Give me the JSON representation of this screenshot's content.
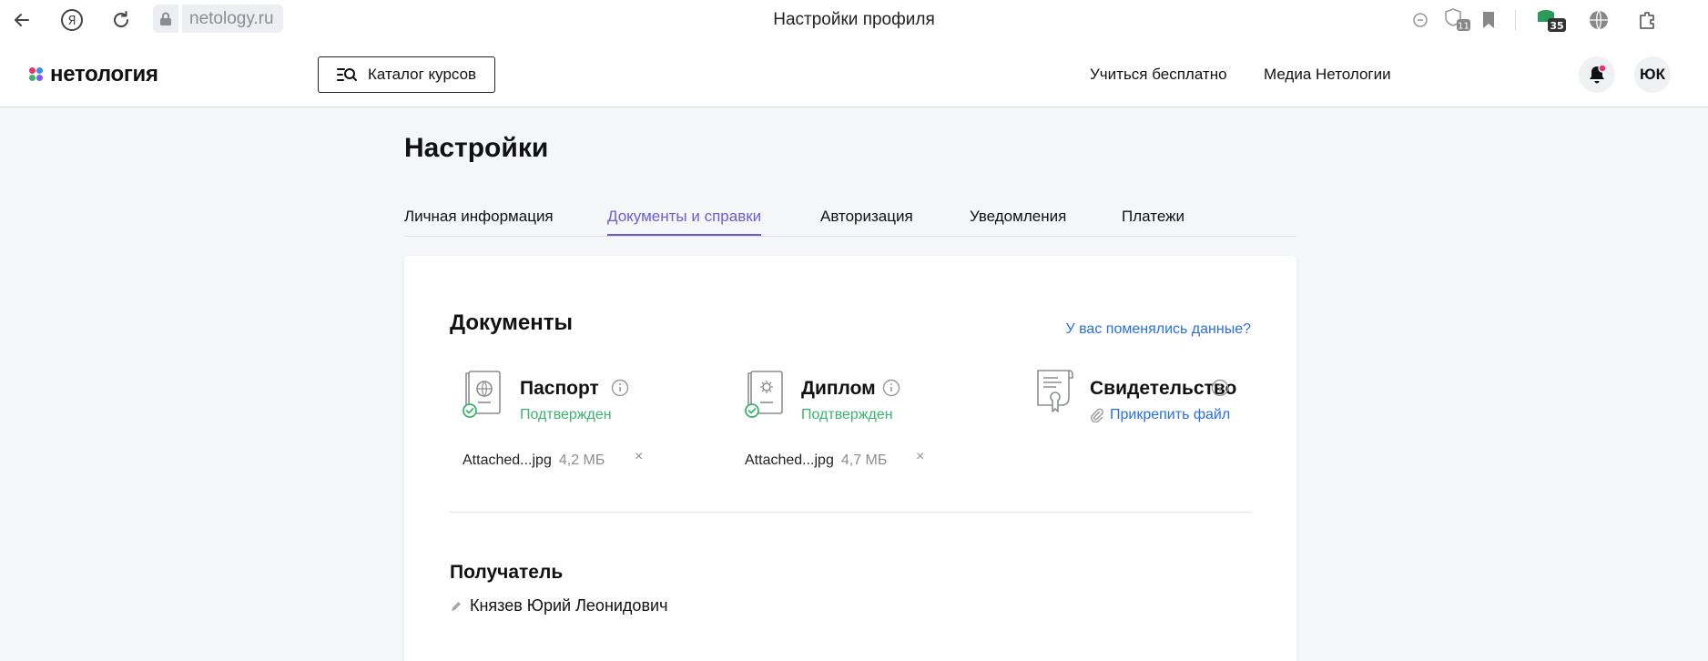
{
  "browser": {
    "url": "netology.ru",
    "tab_title": "Настройки профиля",
    "extensions": {
      "badge_1": "11",
      "badge_2": "35"
    }
  },
  "header": {
    "logo_text": "нетология",
    "catalog_button": "Каталог курсов",
    "nav": [
      "Учиться бесплатно",
      "Медиа Нетологии"
    ],
    "avatar_initials": "ЮК"
  },
  "page": {
    "title": "Настройки",
    "tabs": [
      {
        "label": "Личная информация",
        "active": false
      },
      {
        "label": "Документы и справки",
        "active": true
      },
      {
        "label": "Авторизация",
        "active": false
      },
      {
        "label": "Уведомления",
        "active": false
      },
      {
        "label": "Платежи",
        "active": false
      }
    ]
  },
  "documents": {
    "title": "Документы",
    "changed_link": "У вас поменялись данные?",
    "items": [
      {
        "name": "Паспорт",
        "status": "Подтвержден",
        "file_name": "Attached...jpg",
        "file_size": "4,2 МБ",
        "remove": "×"
      },
      {
        "name": "Диплом",
        "status": "Подтвержден",
        "file_name": "Attached...jpg",
        "file_size": "4,7 МБ",
        "remove": "×"
      },
      {
        "name": "Свидетельство",
        "attach_label": "Прикрепить файл"
      }
    ]
  },
  "recipient": {
    "title": "Получатель",
    "name": "Князев Юрий Леонидович"
  },
  "colors": {
    "accent": "#6a5fd6",
    "link": "#2a6fe0",
    "success": "#3cb371",
    "notification_dot": "#e8336f"
  }
}
